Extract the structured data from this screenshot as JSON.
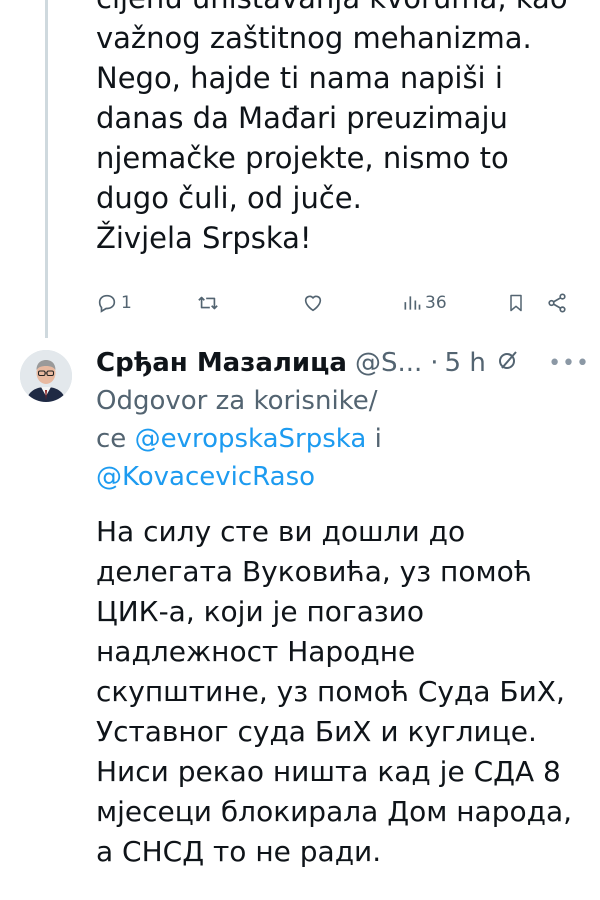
{
  "previous_tweet": {
    "text_lines": "cijenu uništavanja kvoruma, kao\nvažnog zaštitnog mehanizma.\nNego, hajde ti nama napiši i\ndanas da Mađari preuzimaju\nnjemačke projekte, nismo to\ndugo čuli, od juče.\nŽivjela Srpska!",
    "actions": {
      "reply_count": "1",
      "retweet_count": "",
      "like_count": "",
      "views_count": "36"
    }
  },
  "reply_tweet": {
    "author_name": "Срђан Мазалица",
    "author_handle": "@S...",
    "separator": "·",
    "time": "5 h",
    "more": "• • •",
    "reply_to_prefix": "Odgovor za korisnike/\nce ",
    "mention_1": "@evropskaSrpska",
    "conjunction": " i",
    "mention_2": "@KovacevicRaso",
    "text_lines": "На силу сте ви дошли до\nделегата Вуковића, уз помоћ\nЦИК-а, који је погазио\nнадлежност Народне\nскупштине, уз помоћ Суда БиХ,\nУставног суда БиХ и куглице.\nНиси рекао ништа кад је СДА 8\nмјесеци блокирала Дом народа,\nа СНСД то не ради."
  },
  "icons": {
    "reply": "reply-icon",
    "retweet": "retweet-icon",
    "like": "heart-icon",
    "views": "views-bar-icon",
    "bookmark": "bookmark-icon",
    "share": "share-icon",
    "grok": "grok-icon"
  },
  "colors": {
    "text": "#0f1419",
    "secondary": "#536471",
    "link": "#1d9bf0",
    "thread_line": "#cfd9de"
  }
}
